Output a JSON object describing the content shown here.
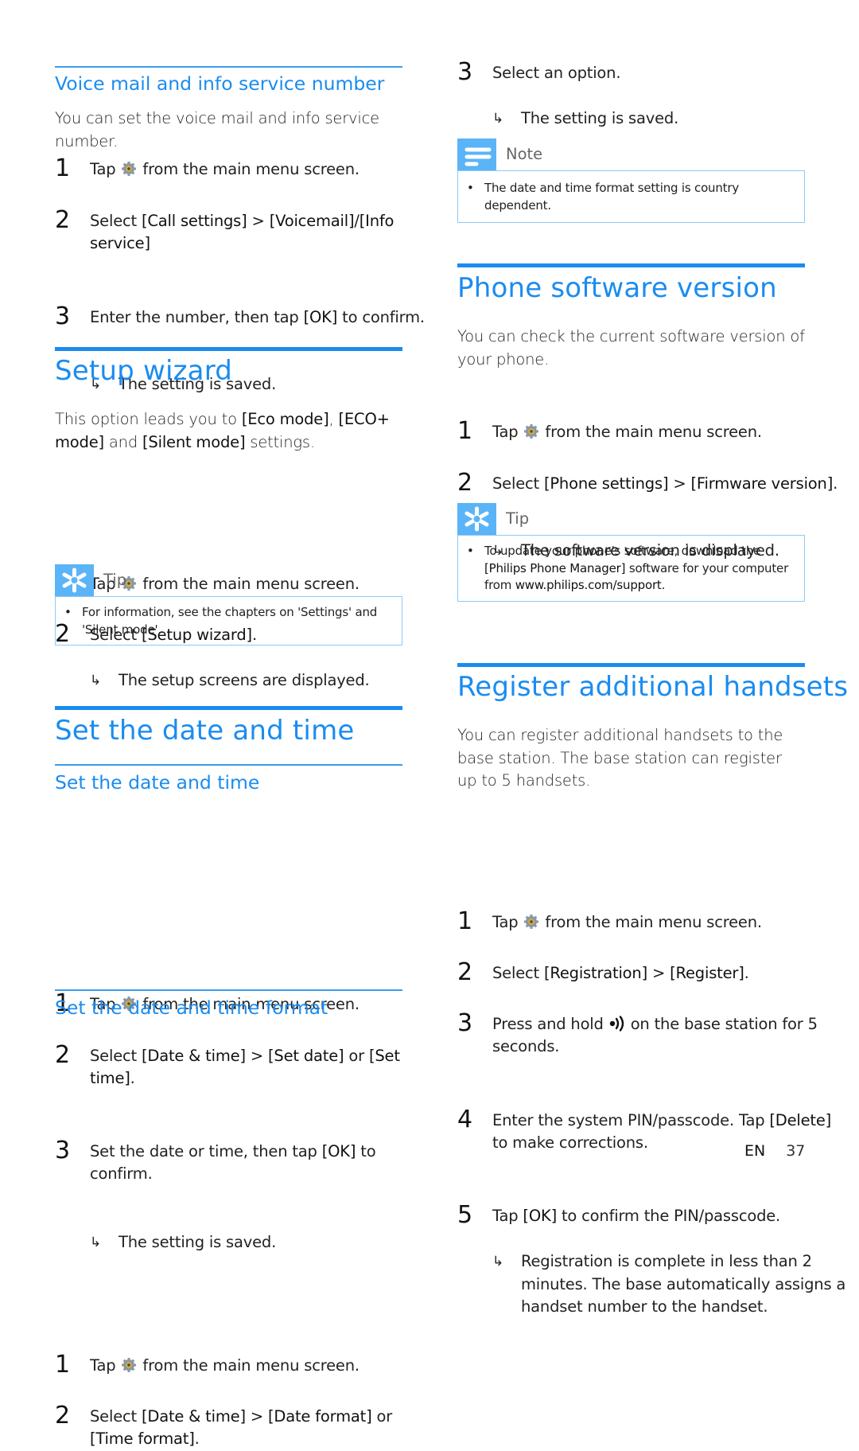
{
  "left": {
    "voicemail": {
      "title": "Voice mail and info service number",
      "intro": "You can set the voice mail and info service number.",
      "steps": [
        {
          "num": "1",
          "pre": "Tap",
          "post": "from the main menu screen."
        },
        {
          "num": "2",
          "pre": "Select",
          "b1": "[Call settings]",
          "mid": ">",
          "b2": "[Voicemail]",
          "sep": "/",
          "b3": "[Info service]"
        },
        {
          "num": "3",
          "pre": "Enter the number, then tap",
          "b1": "[OK]",
          "post": "to confirm."
        }
      ],
      "result": "The setting is saved."
    },
    "setup_wizard": {
      "title": "Setup wizard",
      "intro_pre": "This option leads you to",
      "intro_b1": "[Eco mode]",
      "intro_comma": ",",
      "intro_b2": "[ECO+ mode]",
      "intro_and": "and",
      "intro_b3": "[Silent mode]",
      "intro_post": "settings.",
      "steps": [
        {
          "num": "1",
          "pre": "Tap",
          "post": "from the main menu screen."
        },
        {
          "num": "2",
          "pre": "Select",
          "b1": "[Setup wizard]",
          "post": "."
        }
      ],
      "result": "The setup screens are displayed.",
      "tip": {
        "title": "Tip",
        "text": "For information, see the chapters on 'Settings' and 'Silent mode'."
      }
    },
    "date_time": {
      "title": "Set the date and time",
      "sub1": {
        "title": "Set the date and time",
        "steps": [
          {
            "num": "1",
            "pre": "Tap",
            "post": "from the main menu screen."
          },
          {
            "num": "2",
            "pre": "Select",
            "b1": "[Date & time]",
            "mid": ">",
            "b2": "[Set date]",
            "or": "or",
            "b3": "[Set time]",
            "post": "."
          },
          {
            "num": "3",
            "pre": "Set the date or time, then tap",
            "b1": "[OK]",
            "post": "to confirm."
          }
        ],
        "result": "The setting is saved."
      },
      "sub2": {
        "title": "Set the date and time format",
        "steps": [
          {
            "num": "1",
            "pre": "Tap",
            "post": "from the main menu screen."
          },
          {
            "num": "2",
            "pre": "Select",
            "b1": "[Date & time]",
            "mid": ">",
            "b2": "[Date format]",
            "or": "or",
            "b3": "[Time format]",
            "post": "."
          }
        ]
      }
    }
  },
  "right": {
    "format_cont": {
      "step": {
        "num": "3",
        "text": "Select an option."
      },
      "result": "The setting is saved.",
      "note": {
        "title": "Note",
        "text": "The date and time format setting is country dependent."
      }
    },
    "software": {
      "title": "Phone software version",
      "intro": "You can check the current software version of your phone.",
      "steps": [
        {
          "num": "1",
          "pre": "Tap",
          "post": "from the main menu screen."
        },
        {
          "num": "2",
          "pre": "Select",
          "b1": "[Phone settings]",
          "mid": ">",
          "b2": "[Firmware version]",
          "post": "."
        }
      ],
      "result": "The software version is displayed.",
      "tip": {
        "title": "Tip",
        "pre": "To update your phone's software, download the",
        "b1": "[Philips Phone Manager]",
        "mid": "software for your computer from",
        "b2": "www.philips.com/support",
        "post": "."
      }
    },
    "register": {
      "title": "Register additional handsets",
      "intro": "You can register additional handsets to the base station. The base station can register up to 5 handsets.",
      "steps": [
        {
          "num": "1",
          "pre": "Tap",
          "post": "from the main menu screen."
        },
        {
          "num": "2",
          "pre": "Select",
          "b1": "[Registration]",
          "mid": ">",
          "b2": "[Register]",
          "post": "."
        },
        {
          "num": "3",
          "pre": "Press and hold",
          "post": "on the base station for 5 seconds."
        },
        {
          "num": "4",
          "pre": "Enter the system PIN/passcode. Tap",
          "b1": "[Delete]",
          "post": "to make corrections."
        },
        {
          "num": "5",
          "pre": "Tap",
          "b1": "[OK]",
          "post": "to confirm the PIN/passcode."
        }
      ],
      "result": "Registration is complete in less than 2 minutes. The base automatically assigns a handset number to the handset."
    }
  },
  "footer": {
    "lang": "EN",
    "page": "37"
  },
  "icons": {
    "settings": "settings-gear-icon",
    "result_arrow": "↳",
    "bullet": "•",
    "tip": "asterisk-tip-icon",
    "note": "note-lines-icon",
    "paging": "paging-signal-icon"
  },
  "colors": {
    "accent": "#1a8cf0",
    "box_icon_bg": "#5ab4f7",
    "box_border": "#8ec9f5",
    "text": "#222222"
  }
}
